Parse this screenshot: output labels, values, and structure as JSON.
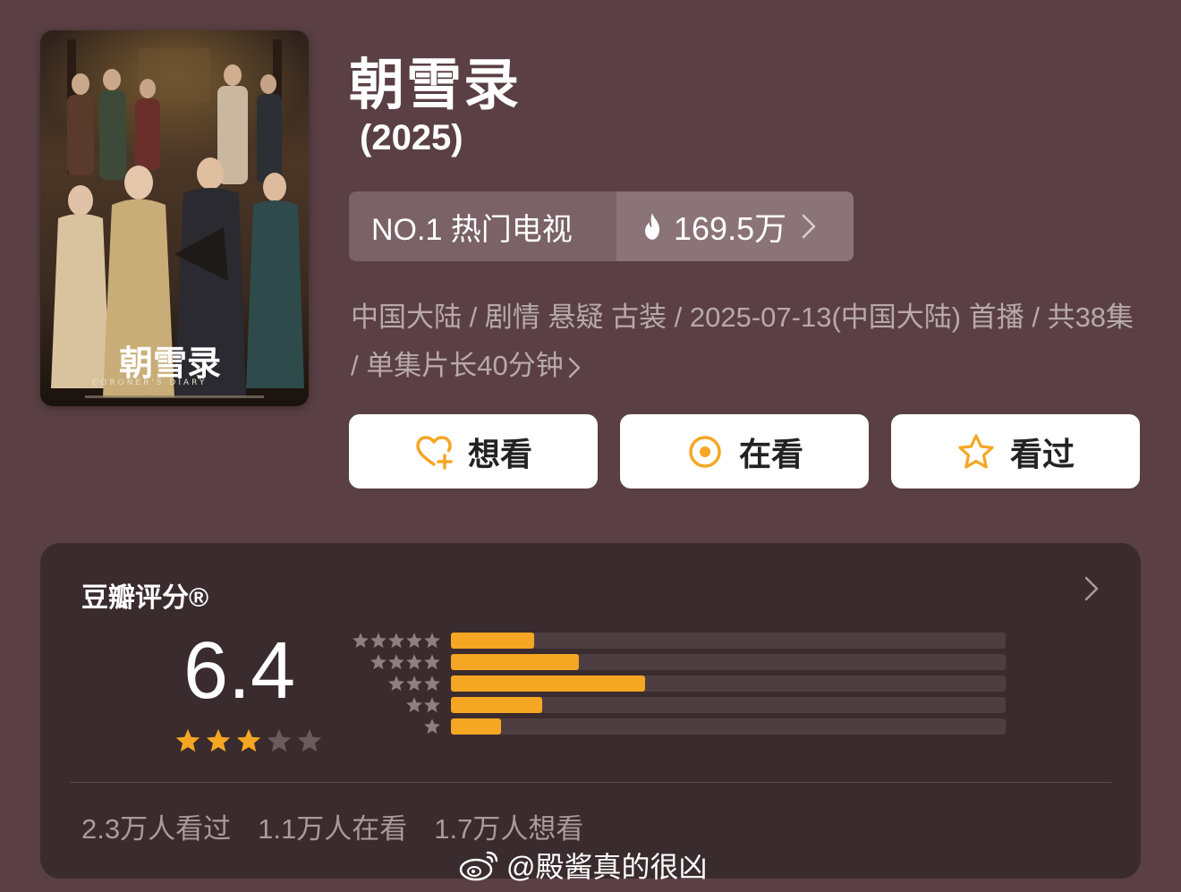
{
  "poster": {
    "calligraphy": "朝雪录",
    "english_title": "CORONER'S DIARY"
  },
  "title": "朝雪录",
  "year": "(2025)",
  "rank": {
    "label": "NO.1 热门电视",
    "heat": "169.5万",
    "heat_icon": "fire-icon"
  },
  "meta": {
    "line": "中国大陆 / 剧情 悬疑 古装 / 2025-07-13(中国大陆) 首播 / 共38集 / 单集片长40分钟"
  },
  "actions": {
    "want": "想看",
    "watching": "在看",
    "watched": "看过"
  },
  "rating": {
    "label": "豆瓣评分®",
    "score": "6.4",
    "stars_filled": 3,
    "stars_total": 5,
    "distribution": [
      {
        "stars": 5,
        "fraction": 0.15
      },
      {
        "stars": 4,
        "fraction": 0.23
      },
      {
        "stars": 3,
        "fraction": 0.35
      },
      {
        "stars": 2,
        "fraction": 0.165
      },
      {
        "stars": 1,
        "fraction": 0.09
      }
    ],
    "watched_count": "2.3万人看过",
    "watching_count": "1.1万人在看",
    "want_count": "1.7万人想看"
  },
  "watermark": "@殿酱真的很凶",
  "colors": {
    "background": "#5a4044",
    "card": "#3a2b2e",
    "accent": "#f5a623",
    "muted_text": "#b8a9ab"
  }
}
